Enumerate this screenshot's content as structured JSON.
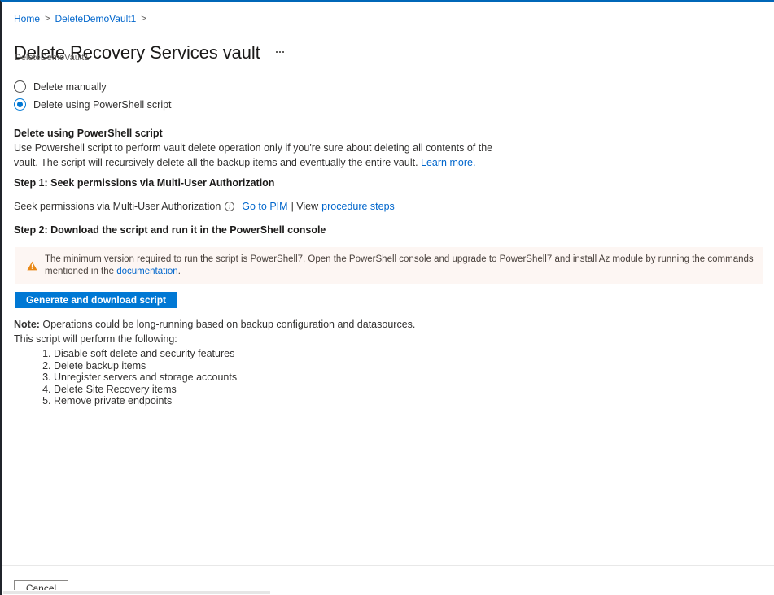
{
  "theme": {
    "accent": "#0078d4",
    "link": "#0066cc",
    "top_border": "#0067b8",
    "warning_bg": "#fdf6f3",
    "warning_icon": "#e98816"
  },
  "breadcrumb": {
    "items": [
      {
        "label": "Home",
        "separator": ">"
      },
      {
        "label": "DeleteDemoVault1",
        "separator": ">"
      }
    ]
  },
  "header": {
    "title": "Delete Recovery Services vault",
    "subtitle": "DeleteDemoVault1",
    "more_menu_label": "..."
  },
  "options": {
    "radios": [
      {
        "label": "Delete manually",
        "checked": false
      },
      {
        "label": "Delete using PowerShell script",
        "checked": true
      }
    ]
  },
  "section": {
    "heading": "Delete using PowerShell script",
    "description_part1": "Use Powershell script to perform vault delete operation only if you're sure about deleting all contents of the vault. The script will recursively delete all the backup items and eventually the entire vault. ",
    "description_link": "Learn more.",
    "step1": {
      "heading": "Step 1: Seek permissions via Multi-User Authorization",
      "text": "Seek permissions via Multi-User Authorization",
      "info_icon_glyph": "i",
      "pim_link": "Go to PIM",
      "middle_text": "| View ",
      "procedure_link": "procedure steps"
    },
    "step2": {
      "heading": "Step 2: Download the script and run it in the PowerShell console"
    }
  },
  "warning": {
    "icon": "warning-triangle-icon",
    "text": "The minimum version required to run the script is PowerShell7. Open the PowerShell console and upgrade to PowerShell7 and install Az module by running the commands mentioned in the ",
    "link": "documentation",
    "suffix": "."
  },
  "actions": {
    "generate_label": "Generate and download script",
    "cancel_label": "Cancel"
  },
  "note": {
    "label": "Note:",
    "text": " Operations could be long-running based on backup configuration and datasources.",
    "second_line": "This script will perform the following:",
    "steps": [
      "Disable soft delete and security features",
      "Delete backup items",
      "Unregister servers and storage accounts",
      "Delete Site Recovery items",
      "Remove private endpoints"
    ]
  }
}
